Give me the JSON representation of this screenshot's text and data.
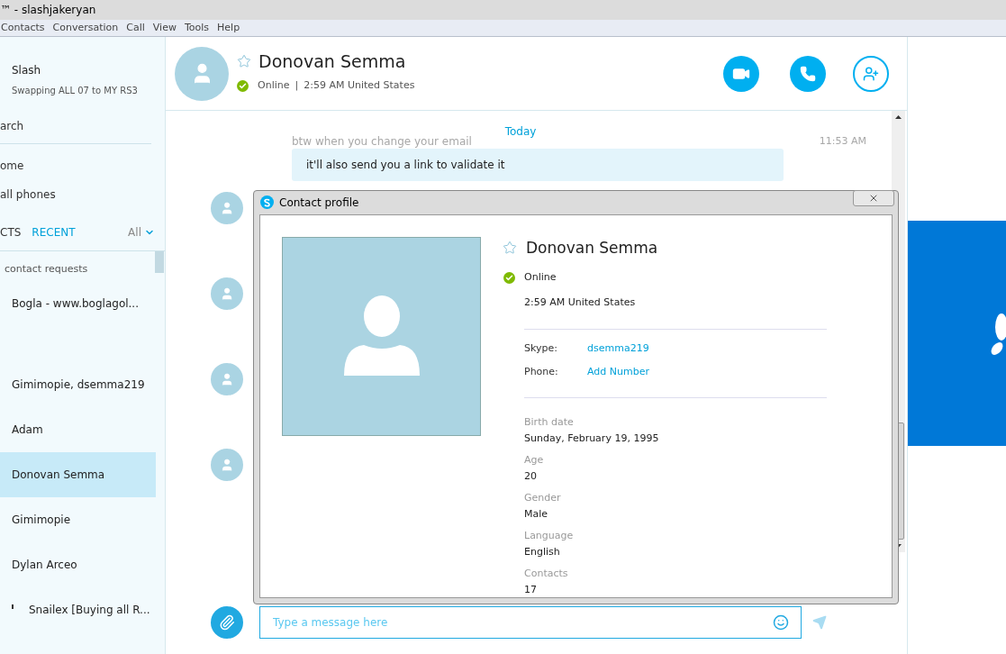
{
  "window": {
    "title": "™ - slashjakeryan"
  },
  "menu": [
    "Contacts",
    "Conversation",
    "Call",
    "View",
    "Tools",
    "Help"
  ],
  "sidebar": {
    "profile": {
      "name": "Slash",
      "mood": "Swapping ALL 07 to MY RS3"
    },
    "nav": [
      "arch",
      "ome",
      "all phones"
    ],
    "tabs": [
      {
        "label": "CTS",
        "selected": false
      },
      {
        "label": "RECENT",
        "selected": true
      }
    ],
    "filter": "All",
    "requests": "contact requests",
    "contacts": [
      {
        "name": "Bogla - www.boglagol...",
        "selected": false,
        "mark": false
      },
      {
        "name": "Gimimopie, dsemma219",
        "selected": false,
        "mark": false
      },
      {
        "name": "Adam",
        "selected": false,
        "mark": false
      },
      {
        "name": "Donovan Semma",
        "selected": true,
        "mark": false
      },
      {
        "name": "Gimimopie",
        "selected": false,
        "mark": false
      },
      {
        "name": "Dylan Arceo",
        "selected": false,
        "mark": false
      },
      {
        "name": "Snailex [Buying all R...",
        "selected": false,
        "mark": true
      }
    ]
  },
  "conversation": {
    "name": "Donovan Semma",
    "status": "Online",
    "separator": "|",
    "local_time": "2:59 AM United States",
    "favorite": false,
    "day": "Today",
    "faded_message": {
      "text": "btw when you change your email",
      "time": "11:53 AM"
    },
    "message": "it'll also send you a link to validate it",
    "input": {
      "placeholder": "Type a message here"
    }
  },
  "profile_dialog": {
    "title": "Contact profile",
    "name": "Donovan Semma",
    "favorite": false,
    "status": "Online",
    "local_time": "2:59 AM United States",
    "accounts": [
      {
        "label": "Skype:",
        "value": "dsemma219"
      },
      {
        "label": "Phone:",
        "value": "Add Number"
      }
    ],
    "details": [
      {
        "label": "Birth date",
        "value": "Sunday, February 19, 1995"
      },
      {
        "label": "Age",
        "value": "20"
      },
      {
        "label": "Gender",
        "value": "Male"
      },
      {
        "label": "Language",
        "value": "English"
      },
      {
        "label": "Contacts",
        "value": "17"
      }
    ]
  }
}
